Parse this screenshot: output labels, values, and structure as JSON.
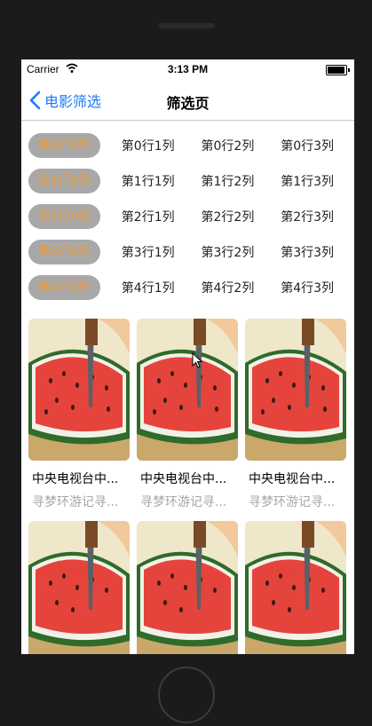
{
  "statusbar": {
    "carrier": "Carrier",
    "time": "3:13 PM"
  },
  "navbar": {
    "back_label": "电影筛选",
    "title": "筛选页"
  },
  "filter_rows": [
    [
      "第0行0列",
      "第0行1列",
      "第0行2列",
      "第0行3列"
    ],
    [
      "第1行0列",
      "第1行1列",
      "第1行2列",
      "第1行3列"
    ],
    [
      "第2行0列",
      "第2行1列",
      "第2行2列",
      "第2行3列"
    ],
    [
      "第3行0列",
      "第3行1列",
      "第3行2列",
      "第3行3列"
    ],
    [
      "第4行0列",
      "第4行1列",
      "第4行2列",
      "第4行3列"
    ]
  ],
  "cards": [
    {
      "title": "中央电视台中...",
      "subtitle": "寻梦环游记寻..."
    },
    {
      "title": "中央电视台中...",
      "subtitle": "寻梦环游记寻..."
    },
    {
      "title": "中央电视台中...",
      "subtitle": "寻梦环游记寻..."
    },
    {
      "title": "",
      "subtitle": ""
    },
    {
      "title": "",
      "subtitle": ""
    },
    {
      "title": "",
      "subtitle": ""
    }
  ],
  "colors": {
    "accent": "#1b7cf5",
    "selected_text": "#e99a3b",
    "selected_bg": "#a8a8a8",
    "subtitle": "#a6a6a6"
  }
}
